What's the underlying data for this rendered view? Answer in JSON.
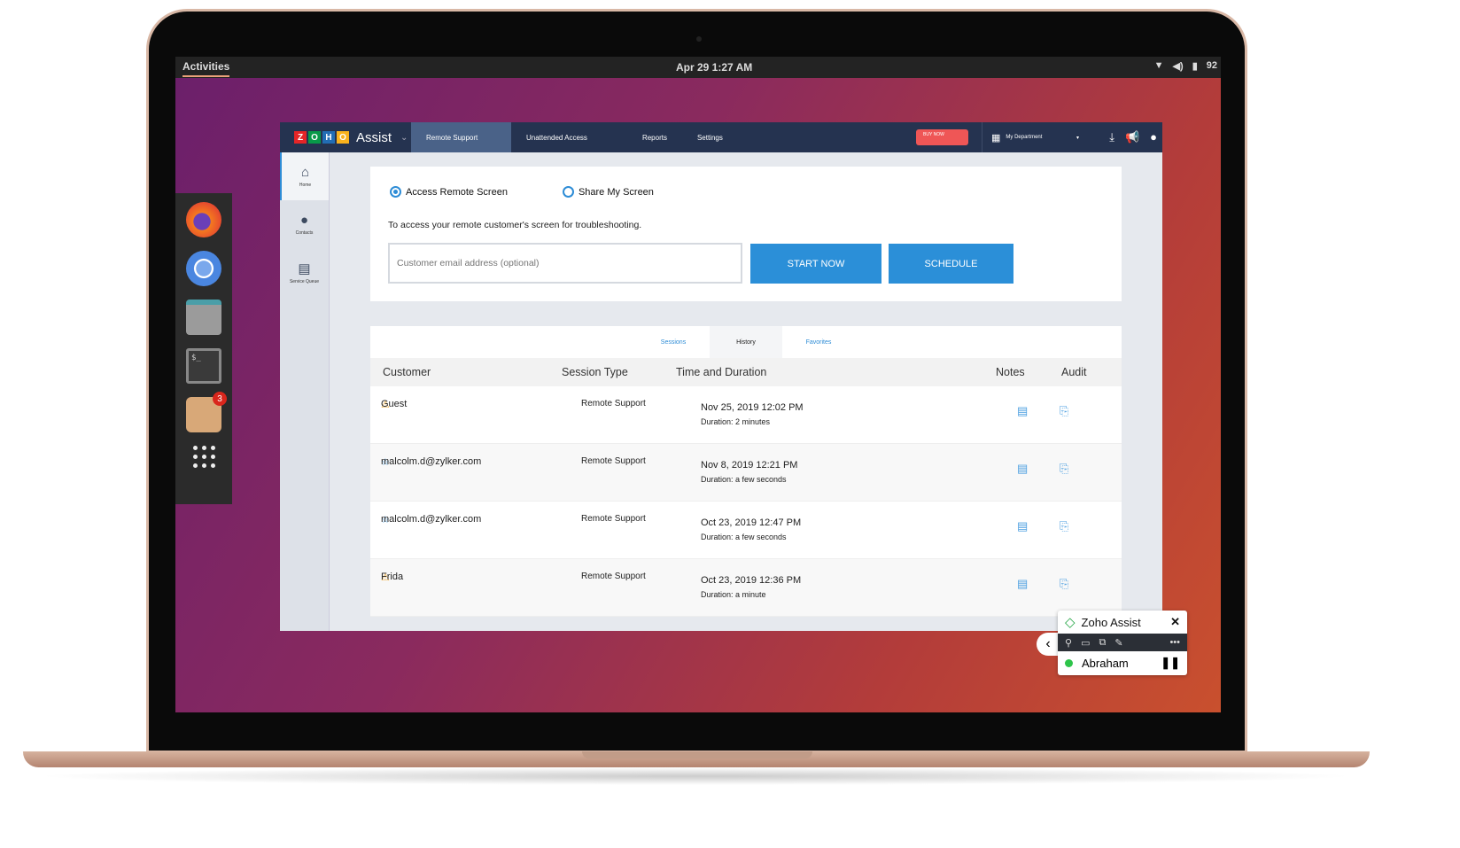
{
  "topbar": {
    "activities": "Activities",
    "clock": "Apr 29  1:27 AM",
    "battery": "92"
  },
  "dock": {
    "apps": [
      {
        "name": "firefox"
      },
      {
        "name": "chrome"
      },
      {
        "name": "files"
      },
      {
        "name": "terminal",
        "glyph": "$_"
      },
      {
        "name": "software",
        "badge": "3"
      }
    ]
  },
  "app": {
    "brand": {
      "tiles": [
        "Z",
        "O",
        "H",
        "O"
      ],
      "name": "Assist"
    },
    "nav": {
      "tabs": [
        "Remote Support",
        "Unattended Access",
        "Reports",
        "Settings"
      ],
      "buy_now": "BUY NOW",
      "department": "My Department"
    },
    "sidebar": [
      {
        "label": "Home"
      },
      {
        "label": "Contacts"
      },
      {
        "label": "Service Queue"
      }
    ],
    "start": {
      "option_access": "Access Remote Screen",
      "option_share": "Share My Screen",
      "description": "To access your remote customer's screen for troubleshooting.",
      "email_placeholder": "Customer email address (optional)",
      "start_now": "START NOW",
      "schedule": "SCHEDULE"
    },
    "history": {
      "tabs": [
        "Sessions",
        "History",
        "Favorites"
      ],
      "columns": [
        "Customer",
        "Session Type",
        "Time and Duration",
        "Notes",
        "Audit"
      ],
      "rows": [
        {
          "icon": "warning",
          "customer": "Guest",
          "type": "Remote Support",
          "time": "Nov 25, 2019 12:02 PM",
          "duration": "Duration: 2 minutes"
        },
        {
          "icon": "star",
          "customer": "malcolm.d@zylker.com",
          "type": "Remote Support",
          "time": "Nov 8, 2019 12:21 PM",
          "duration": "Duration: a few seconds"
        },
        {
          "icon": "star",
          "customer": "malcolm.d@zylker.com",
          "type": "Remote Support",
          "time": "Oct 23, 2019 12:47 PM",
          "duration": "Duration: a few seconds"
        },
        {
          "icon": "warning",
          "customer": "Frida",
          "type": "Remote Support",
          "time": "Oct 23, 2019 12:36 PM",
          "duration": "Duration: a minute"
        }
      ]
    }
  },
  "widget": {
    "title": "Zoho Assist",
    "user": "Abraham"
  }
}
